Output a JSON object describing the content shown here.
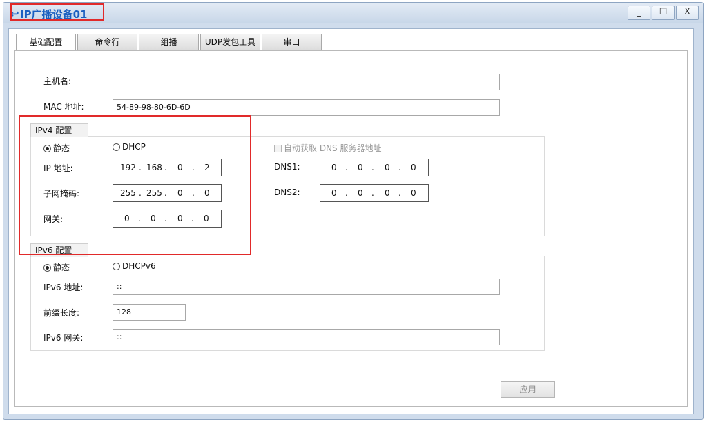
{
  "window": {
    "title": "IP广播设备01",
    "title_icon": "app-logo-icon",
    "controls": {
      "minimize": "_",
      "maximize": "☐",
      "close": "X"
    }
  },
  "tabs": [
    {
      "label": "基础配置",
      "active": true
    },
    {
      "label": "命令行",
      "active": false
    },
    {
      "label": "组播",
      "active": false
    },
    {
      "label": "UDP发包工具",
      "active": false
    },
    {
      "label": "串口",
      "active": false
    }
  ],
  "basic": {
    "hostname_label": "主机名:",
    "hostname_value": "",
    "mac_label": "MAC 地址:",
    "mac_value": "54-89-98-80-6D-6D"
  },
  "ipv4": {
    "group_title": "IPv4 配置",
    "static_label": "静态",
    "dhcp_label": "DHCP",
    "static_selected": true,
    "auto_dns_label": "自动获取 DNS 服务器地址",
    "ip_label": "IP 地址:",
    "ip_octets": [
      "192",
      "168",
      "0",
      "2"
    ],
    "mask_label": "子网掩码:",
    "mask_octets": [
      "255",
      "255",
      "0",
      "0"
    ],
    "gateway_label": "网关:",
    "gateway_octets": [
      "0",
      "0",
      "0",
      "0"
    ],
    "dns1_label": "DNS1:",
    "dns1_octets": [
      "0",
      "0",
      "0",
      "0"
    ],
    "dns2_label": "DNS2:",
    "dns2_octets": [
      "0",
      "0",
      "0",
      "0"
    ]
  },
  "ipv6": {
    "group_title": "IPv6 配置",
    "static_label": "静态",
    "dhcp_label": "DHCPv6",
    "static_selected": true,
    "address_label": "IPv6 地址:",
    "address_value": "::",
    "prefix_label": "前缀长度:",
    "prefix_value": "128",
    "gateway_label": "IPv6 网关:",
    "gateway_value": "::"
  },
  "apply_label": "应用",
  "colors": {
    "highlight": "#e12a2a",
    "title": "#1a5fc0",
    "frame": "#cfdcec"
  }
}
